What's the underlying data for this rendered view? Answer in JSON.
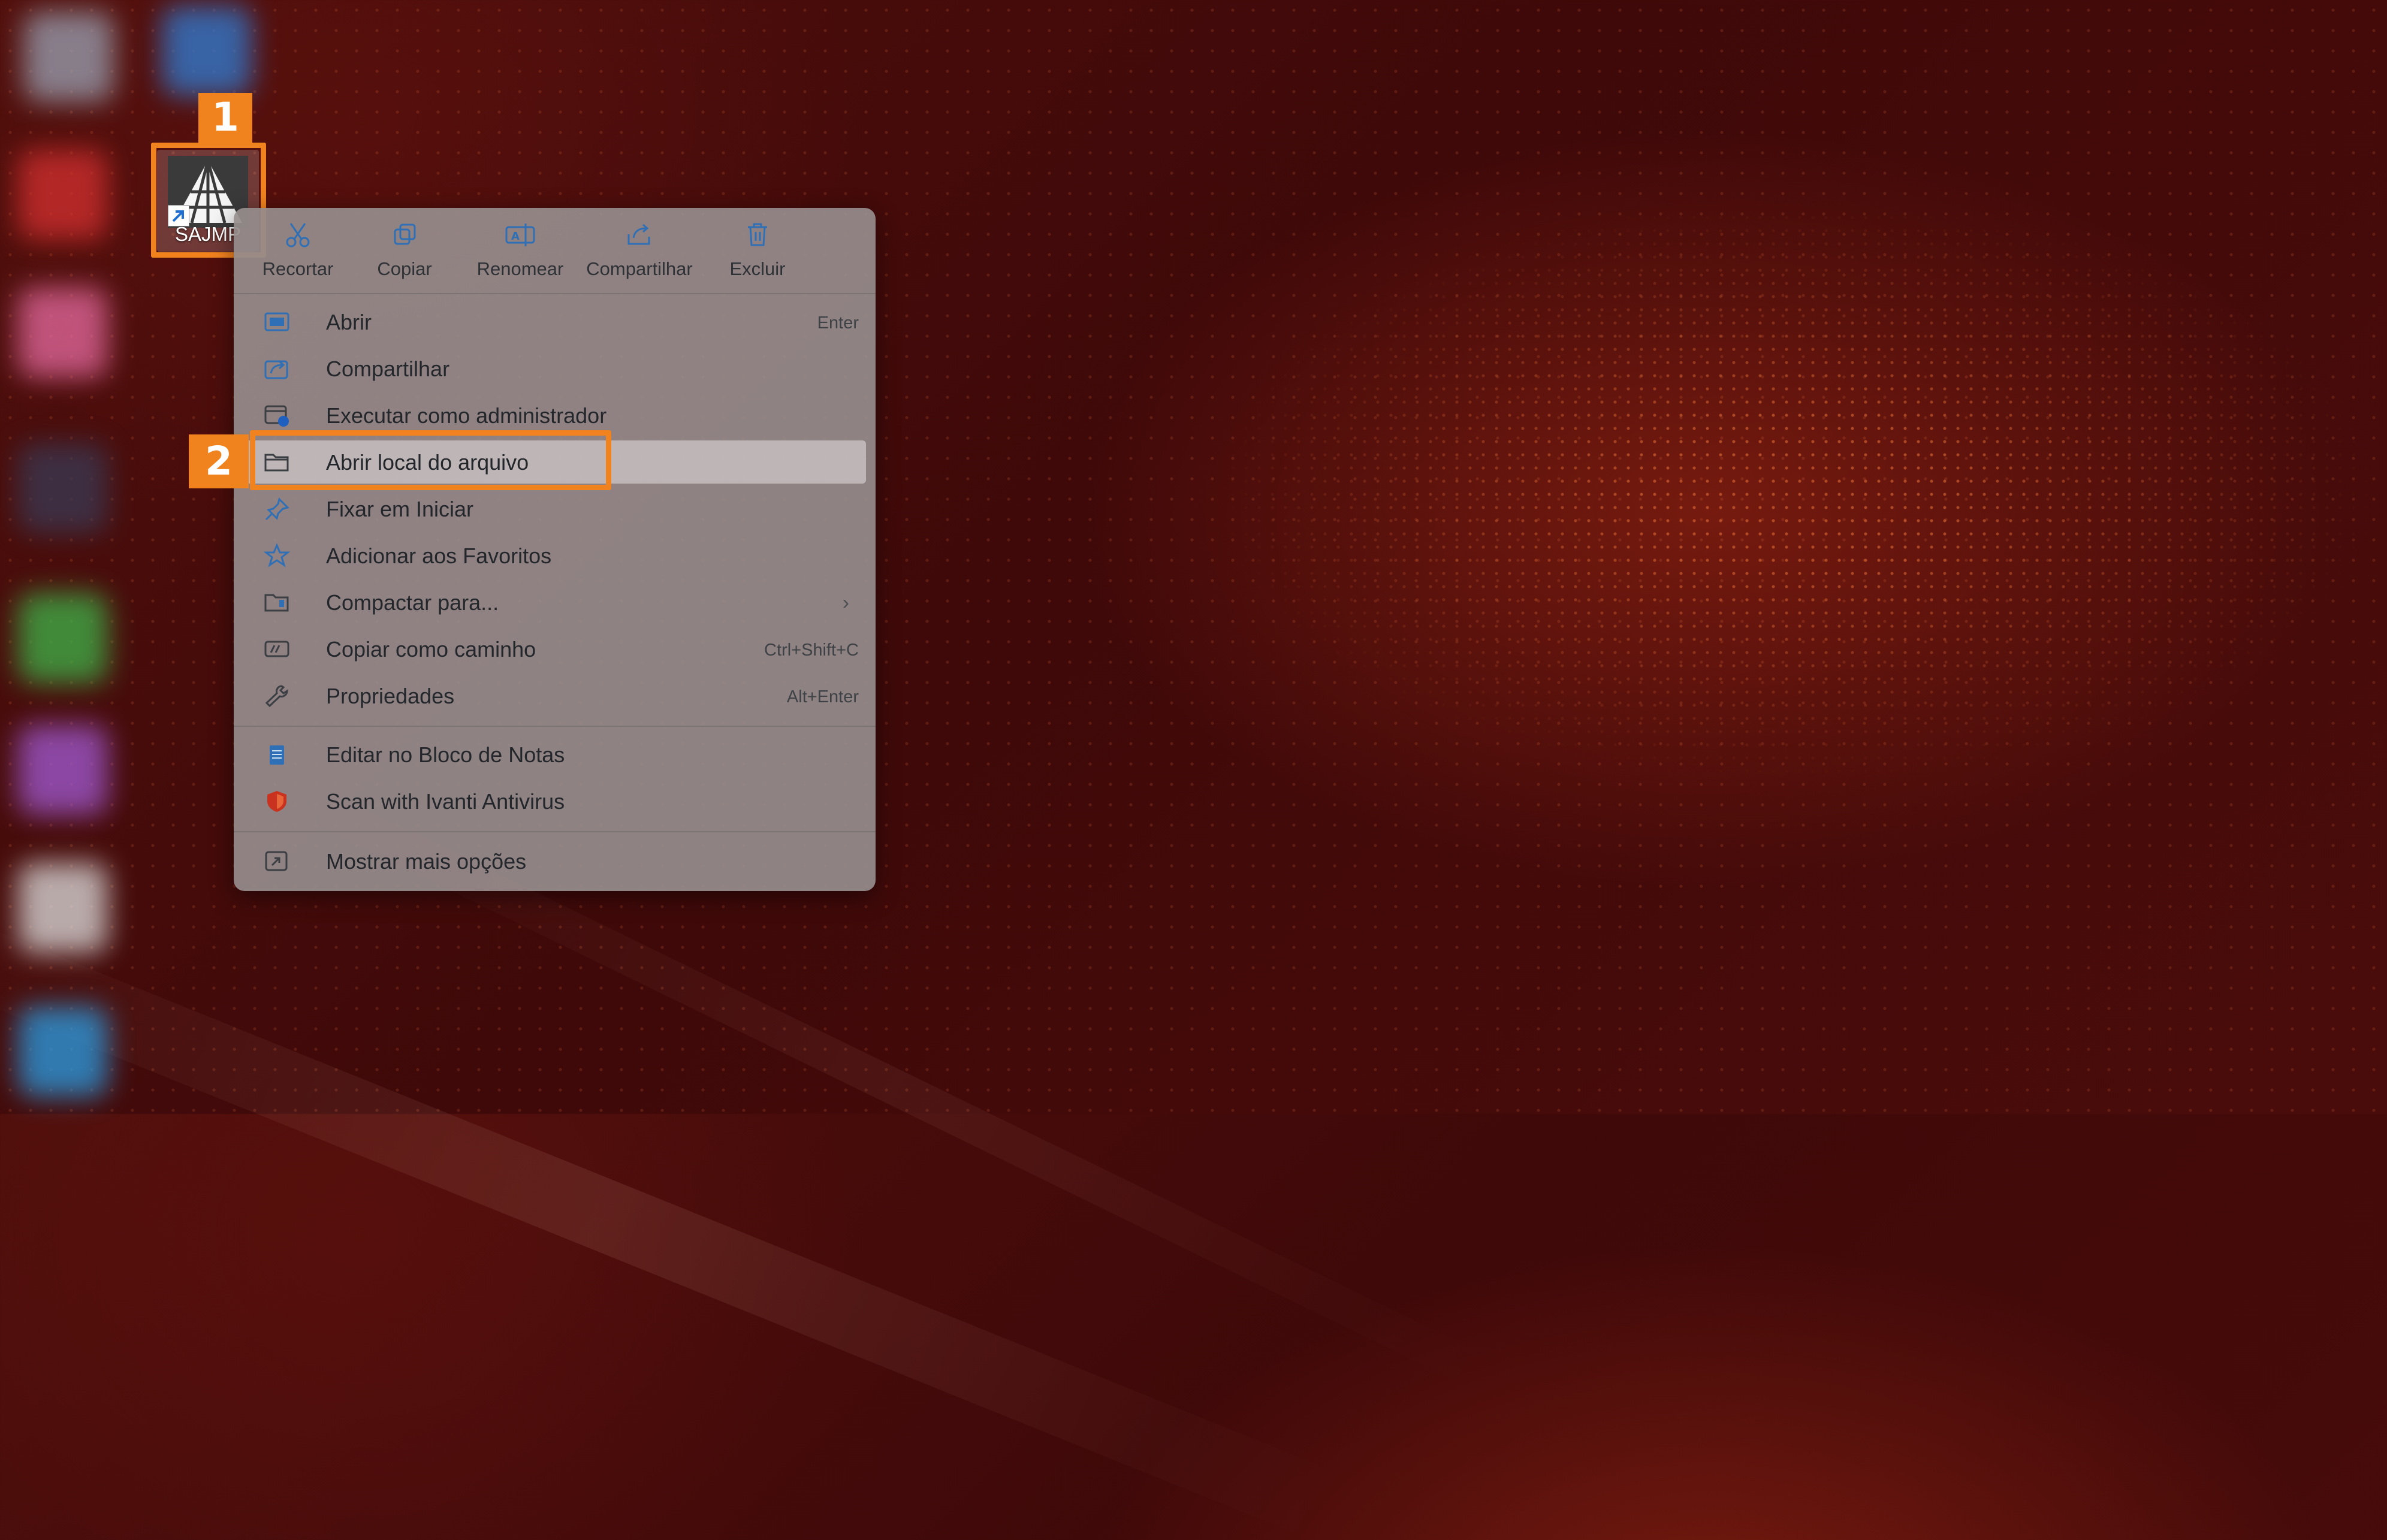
{
  "desktop": {
    "icon_label": "SAJMP",
    "callout_1": "1",
    "callout_2": "2"
  },
  "toolbar": [
    {
      "label": "Recortar",
      "icon": "scissors-icon"
    },
    {
      "label": "Copiar",
      "icon": "copy-icon"
    },
    {
      "label": "Renomear",
      "icon": "rename-icon"
    },
    {
      "label": "Compartilhar",
      "icon": "share-icon"
    },
    {
      "label": "Excluir",
      "icon": "trash-icon"
    }
  ],
  "menu": {
    "group1": [
      {
        "label": "Abrir",
        "shortcut": "Enter",
        "icon": "open-window-icon"
      },
      {
        "label": "Compartilhar",
        "shortcut": "",
        "icon": "share-icon"
      },
      {
        "label": "Executar como administrador",
        "shortcut": "",
        "icon": "admin-shield-icon"
      },
      {
        "label": "Abrir local do arquivo",
        "shortcut": "",
        "icon": "folder-icon"
      },
      {
        "label": "Fixar em Iniciar",
        "shortcut": "",
        "icon": "pin-icon"
      },
      {
        "label": "Adicionar aos Favoritos",
        "shortcut": "",
        "icon": "star-icon"
      },
      {
        "label": "Compactar para...",
        "shortcut": "",
        "icon": "archive-icon"
      },
      {
        "label": "Copiar como caminho",
        "shortcut": "Ctrl+Shift+C",
        "icon": "path-icon"
      },
      {
        "label": "Propriedades",
        "shortcut": "Alt+Enter",
        "icon": "wrench-icon"
      }
    ],
    "group2": [
      {
        "label": "Editar no Bloco de Notas",
        "icon": "notepad-icon"
      },
      {
        "label": "Scan with Ivanti Antivirus",
        "icon": "ivanti-shield-icon"
      }
    ],
    "group3": [
      {
        "label": "Mostrar mais opções",
        "icon": "more-options-icon"
      }
    ]
  },
  "colors": {
    "accent": "#f0831e",
    "menu_bg": "#968c8c",
    "desktop_bg": "#4a0c0a"
  }
}
